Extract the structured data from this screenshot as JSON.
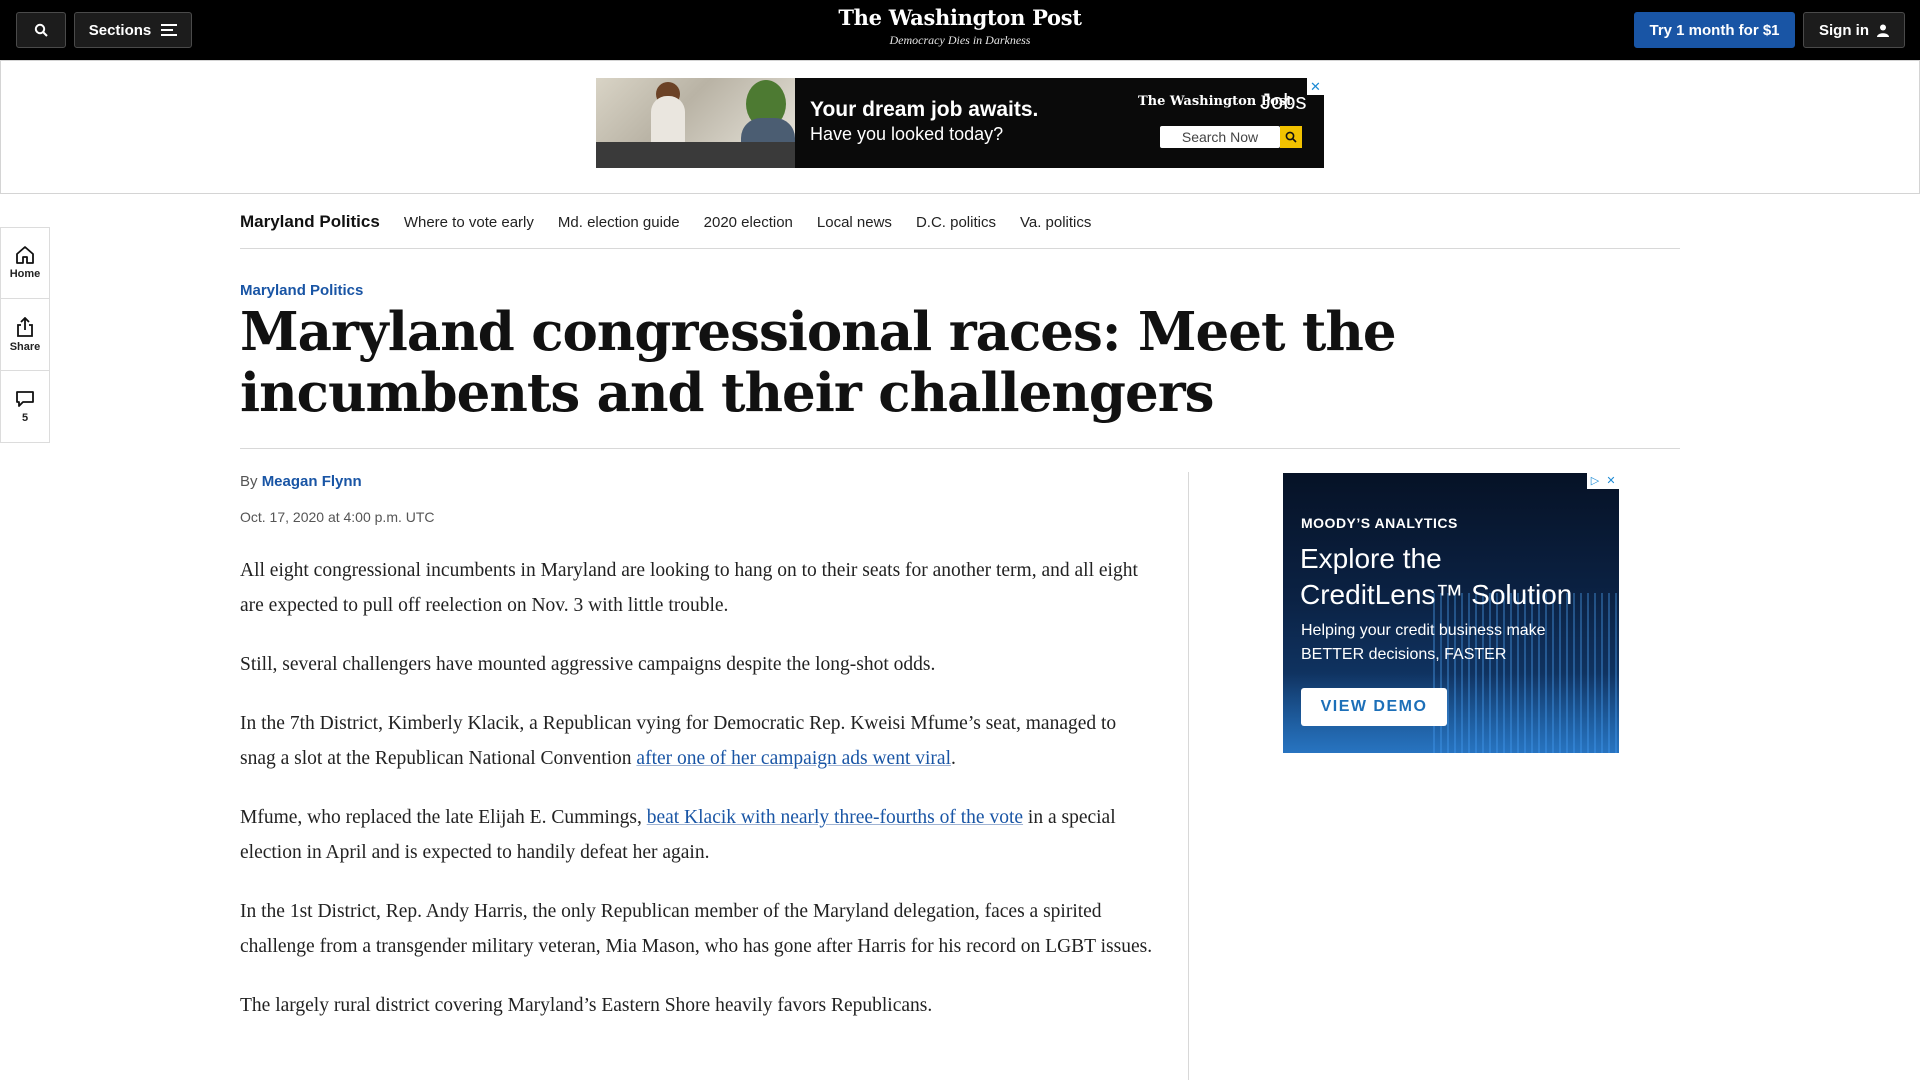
{
  "header": {
    "sections_label": "Sections",
    "masthead": "The Washington Post",
    "tagline": "Democracy Dies in Darkness",
    "subscribe_label": "Try 1 month for $1",
    "signin_label": "Sign in"
  },
  "top_ad": {
    "headline": "Your dream job awaits.",
    "subline": "Have you looked today?",
    "brand": "The Washington Post",
    "brand_suffix": "Jobs",
    "search_label": "Search Now",
    "close_glyph": "✕"
  },
  "section_nav": {
    "title": "Maryland Politics",
    "links": [
      "Where to vote early",
      "Md. election guide",
      "2020 election",
      "Local news",
      "D.C. politics",
      "Va. politics"
    ]
  },
  "rail": {
    "home_label": "Home",
    "share_label": "Share",
    "comments_count": "5"
  },
  "article": {
    "kicker": "Maryland Politics",
    "headline": "Maryland congressional races: Meet the incumbents and their challengers",
    "byline_prefix": "By",
    "author": "Meagan Flynn",
    "date": "Oct. 17, 2020 at 4:00 p.m. UTC",
    "p1": "All eight congressional incumbents in Maryland are looking to hang on to their seats for another term, and all eight are expected to pull off reelection on Nov. 3 with little trouble.",
    "p2": "Still, several challengers have mounted aggressive campaigns despite the long-shot odds.",
    "p3_before": "In the 7th District, Kimberly Klacik, a Republican vying for Democratic Rep. Kweisi Mfume’s seat, managed to snag a slot at the Republican National Convention ",
    "p3_link": "after one of her campaign ads went viral",
    "p3_after": ".",
    "p4_before": "Mfume, who replaced the late Elijah E. Cummings, ",
    "p4_link": "beat Klacik with nearly three-fourths of the vote",
    "p4_after": " in a special election in April and is expected to handily defeat her again.",
    "p5": "In the 1st District, Rep. Andy Harris, the only Republican member of the Maryland delegation, faces a spirited challenge from a transgender military veteran, Mia Mason, who has gone after Harris for his record on LGBT issues.",
    "p6": "The largely rural district covering Maryland’s Eastern Shore heavily favors Republicans."
  },
  "side_ad": {
    "brand": "MOODY’S ANALYTICS",
    "headline": "Explore the CreditLens™ Solution",
    "subline": "Helping your credit business make BETTER decisions, FASTER",
    "cta": "VIEW DEMO",
    "adchoices_glyph": "▷",
    "close_glyph": "✕"
  }
}
